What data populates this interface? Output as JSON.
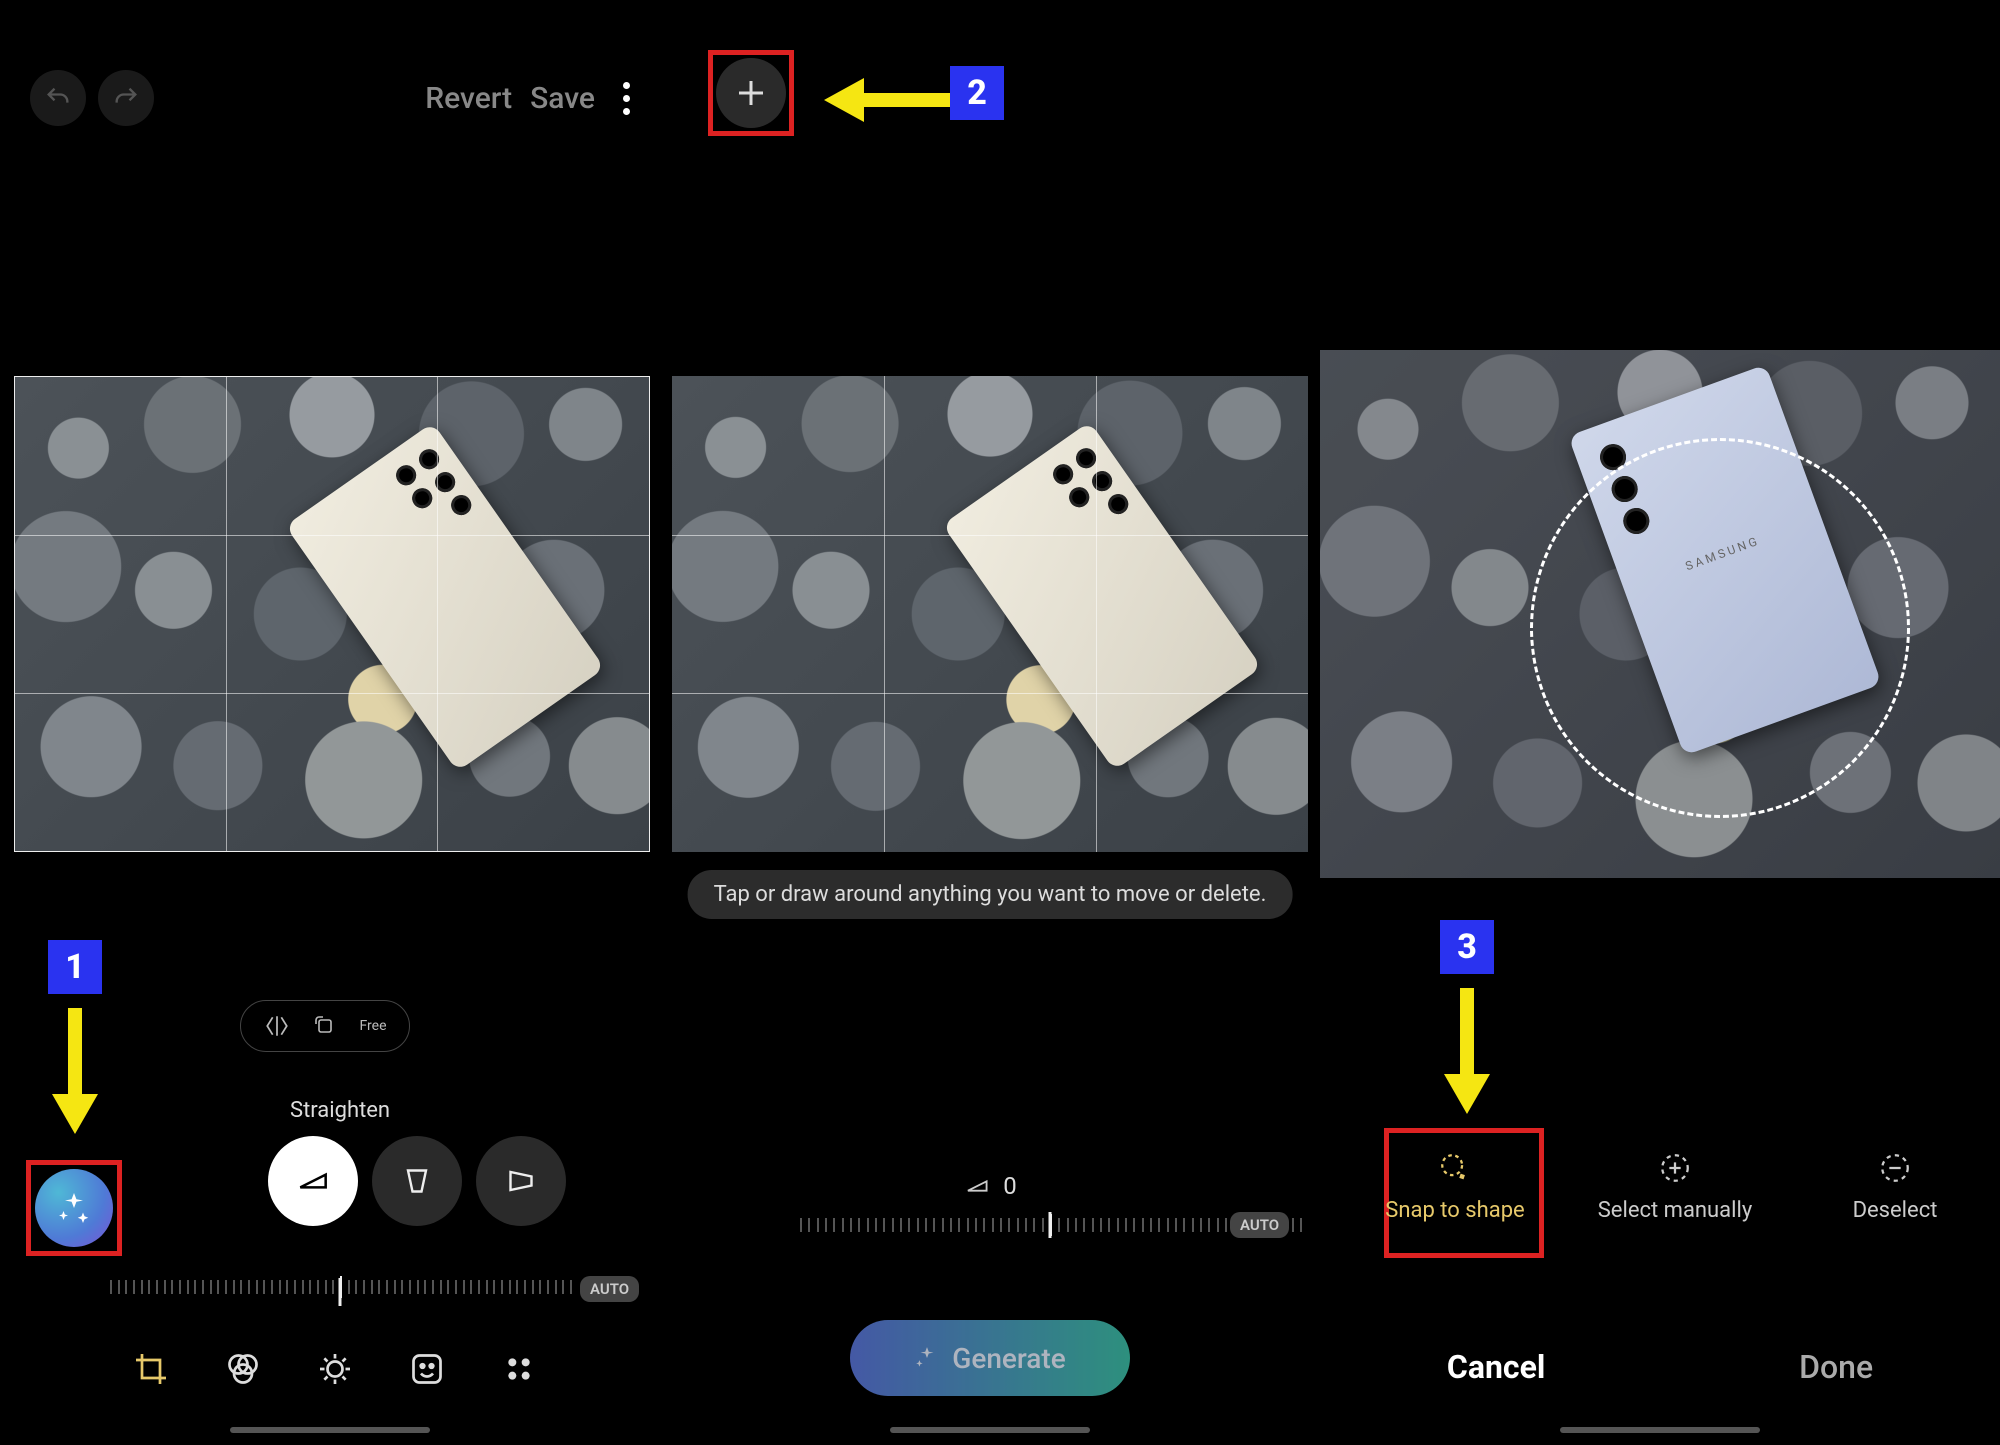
{
  "annotations": {
    "step1": "1",
    "step2": "2",
    "step3": "3"
  },
  "left": {
    "revert": "Revert",
    "save": "Save",
    "ratio_free": "Free",
    "straighten_label": "Straighten",
    "auto": "AUTO"
  },
  "middle": {
    "hint": "Tap or draw around anything you want to move or delete.",
    "value": "0",
    "auto": "AUTO",
    "generate": "Generate"
  },
  "right": {
    "snap": "Snap to shape",
    "manual": "Select manually",
    "deselect": "Deselect",
    "cancel": "Cancel",
    "done": "Done"
  },
  "phone_brand": "SAMSUNG"
}
